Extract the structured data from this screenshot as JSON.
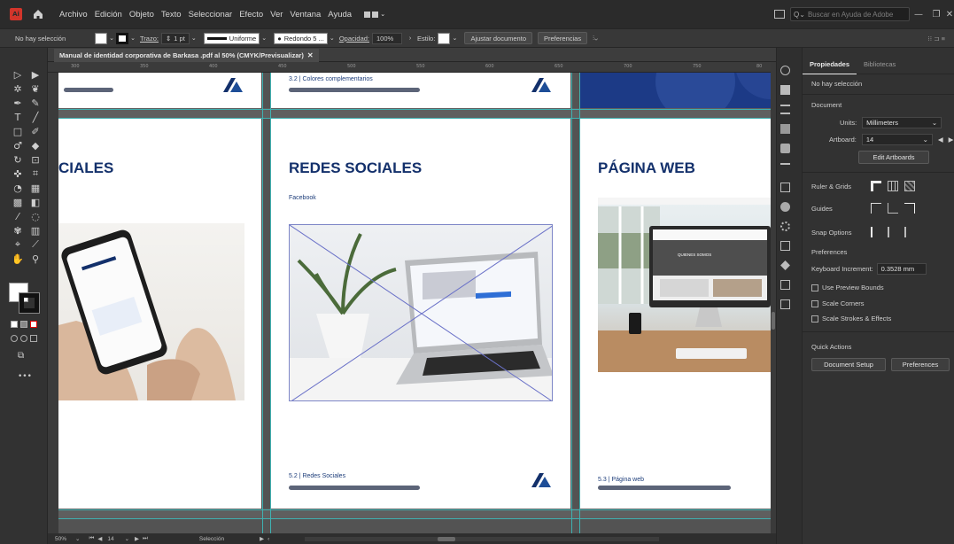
{
  "menubar": {
    "app_badge": "Ai",
    "items": [
      "Archivo",
      "Edición",
      "Objeto",
      "Texto",
      "Seleccionar",
      "Efecto",
      "Ver",
      "Ventana",
      "Ayuda"
    ],
    "search_placeholder": "Buscar en Ayuda de Adobe"
  },
  "controlbar": {
    "selection": "No hay selección",
    "stroke_label": "Trazo:",
    "stroke_weight": "1 pt",
    "stroke_profile": "Uniforme",
    "brush": "Redondo 5 ...",
    "opacity_label": "Opacidad:",
    "opacity_value": "100%",
    "style_label": "Estilo:",
    "fit_document": "Ajustar documento",
    "preferences": "Preferencias"
  },
  "document": {
    "tab_title": "Manual de identidad corporativa de Barkasa .pdf al 50% (CMYK/Previsualizar)"
  },
  "rulers": {
    "top_ticks": [
      "300",
      "350",
      "400",
      "450",
      "500",
      "550",
      "600",
      "650",
      "700",
      "750",
      "80"
    ]
  },
  "artboards": {
    "left": {
      "title": "CIALES"
    },
    "middle": {
      "top_caption": "3.2 | Colores complementarios",
      "title": "REDES SOCIALES",
      "subtitle": "Facebook",
      "footer_caption": "5.2 | Redes Sociales"
    },
    "right": {
      "title": "PÁGINA WEB",
      "footer_caption": "5.3 | Página web",
      "screen_text": "QUIENES SOMOS"
    }
  },
  "statusbar": {
    "zoom": "50%",
    "artboard_number": "14",
    "tool": "Selección"
  },
  "panel": {
    "tabs": [
      "Propiedades",
      "Bibliotecas"
    ],
    "selection": "No hay selección",
    "document_label": "Document",
    "units_label": "Units:",
    "units_value": "Millimeters",
    "artboard_label": "Artboard:",
    "artboard_value": "14",
    "edit_artboards": "Edit Artboards",
    "ruler_grids": "Ruler & Grids",
    "guides": "Guides",
    "snap_options": "Snap Options",
    "preferences_label": "Preferences",
    "keyboard_increment_label": "Keyboard Increment:",
    "keyboard_increment_value": "0.3528 mm",
    "use_preview_bounds": "Use Preview Bounds",
    "scale_corners": "Scale Corners",
    "scale_strokes": "Scale Strokes & Effects",
    "quick_actions": "Quick Actions",
    "document_setup": "Document Setup",
    "preferences_button": "Preferences"
  },
  "colors": {
    "brand_navy": "#13306b",
    "guide_cyan": "#3fb0b0",
    "ai_red": "#d2352b"
  }
}
